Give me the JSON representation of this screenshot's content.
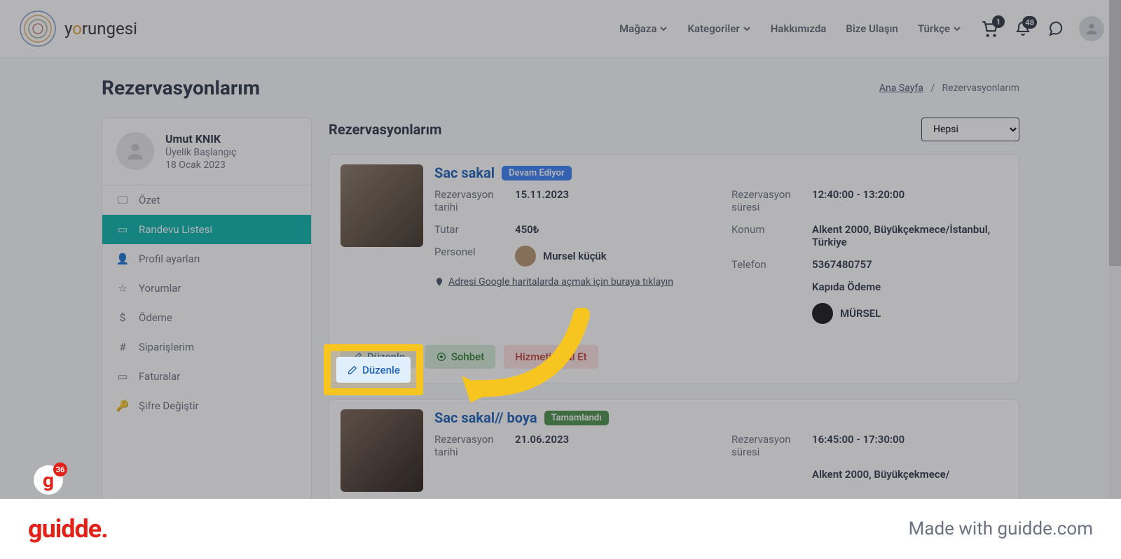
{
  "brand": {
    "name": "yorungesi"
  },
  "nav": {
    "store": "Mağaza",
    "categories": "Kategoriler",
    "about": "Hakkımızda",
    "contact": "Bize Ulaşın",
    "lang": "Türkçe"
  },
  "header": {
    "cart_badge": "1",
    "bell_badge": "48"
  },
  "page": {
    "title": "Rezervasyonlarım",
    "crumb_home": "Ana Sayfa",
    "crumb_sep": "/",
    "crumb_current": "Rezervasyonlarım"
  },
  "profile": {
    "name": "Umut KNIK",
    "membership_label": "Üyelik Başlangıç",
    "membership_date": "18 Ocak 2023"
  },
  "sidebar": {
    "items": [
      {
        "label": "Özet"
      },
      {
        "label": "Randevu Listesi"
      },
      {
        "label": "Profil ayarları"
      },
      {
        "label": "Yorumlar"
      },
      {
        "label": "Ödeme"
      },
      {
        "label": "Siparişlerim"
      },
      {
        "label": "Faturalar"
      },
      {
        "label": "Şifre Değiştir"
      }
    ]
  },
  "content": {
    "title": "Rezervasyonlarım",
    "filter_selected": "Hepsi"
  },
  "labels": {
    "date": "Rezervasyon tarihi",
    "amount": "Tutar",
    "staff": "Personel",
    "duration": "Rezervasyon süresi",
    "location": "Konum",
    "phone": "Telefon",
    "map_link": "Adresi Google haritalarda açmak için buraya tıklayın"
  },
  "buttons": {
    "edit": "Düzenle",
    "chat": "Sohbet",
    "cancel": "Hizmeti İptal Et"
  },
  "reservations": [
    {
      "title": "Sac sakal",
      "status": "Devam Ediyor",
      "status_class": "status-blue",
      "date": "15.11.2023",
      "amount": "450₺",
      "staff": "Mursel küçük",
      "duration": "12:40:00 - 13:20:00",
      "location": "Alkent 2000, Büyükçekmece/İstanbul, Türkiye",
      "phone": "5367480757",
      "payment": "Kapıda Ödeme",
      "shop": "MÜRSEL"
    },
    {
      "title": "Sac sakal// boya",
      "status": "Tamamlandı",
      "status_class": "status-green",
      "date": "21.06.2023",
      "amount": "",
      "staff": "",
      "duration": "16:45:00 - 17:30:00",
      "location": "Alkent 2000, Büyükçekmece/",
      "phone": "",
      "payment": "",
      "shop": ""
    }
  ],
  "guidde": {
    "logo": "guidde.",
    "made": "Made with guidde.com",
    "float_badge": "36"
  },
  "annot": {
    "edit": "Düzenle"
  }
}
